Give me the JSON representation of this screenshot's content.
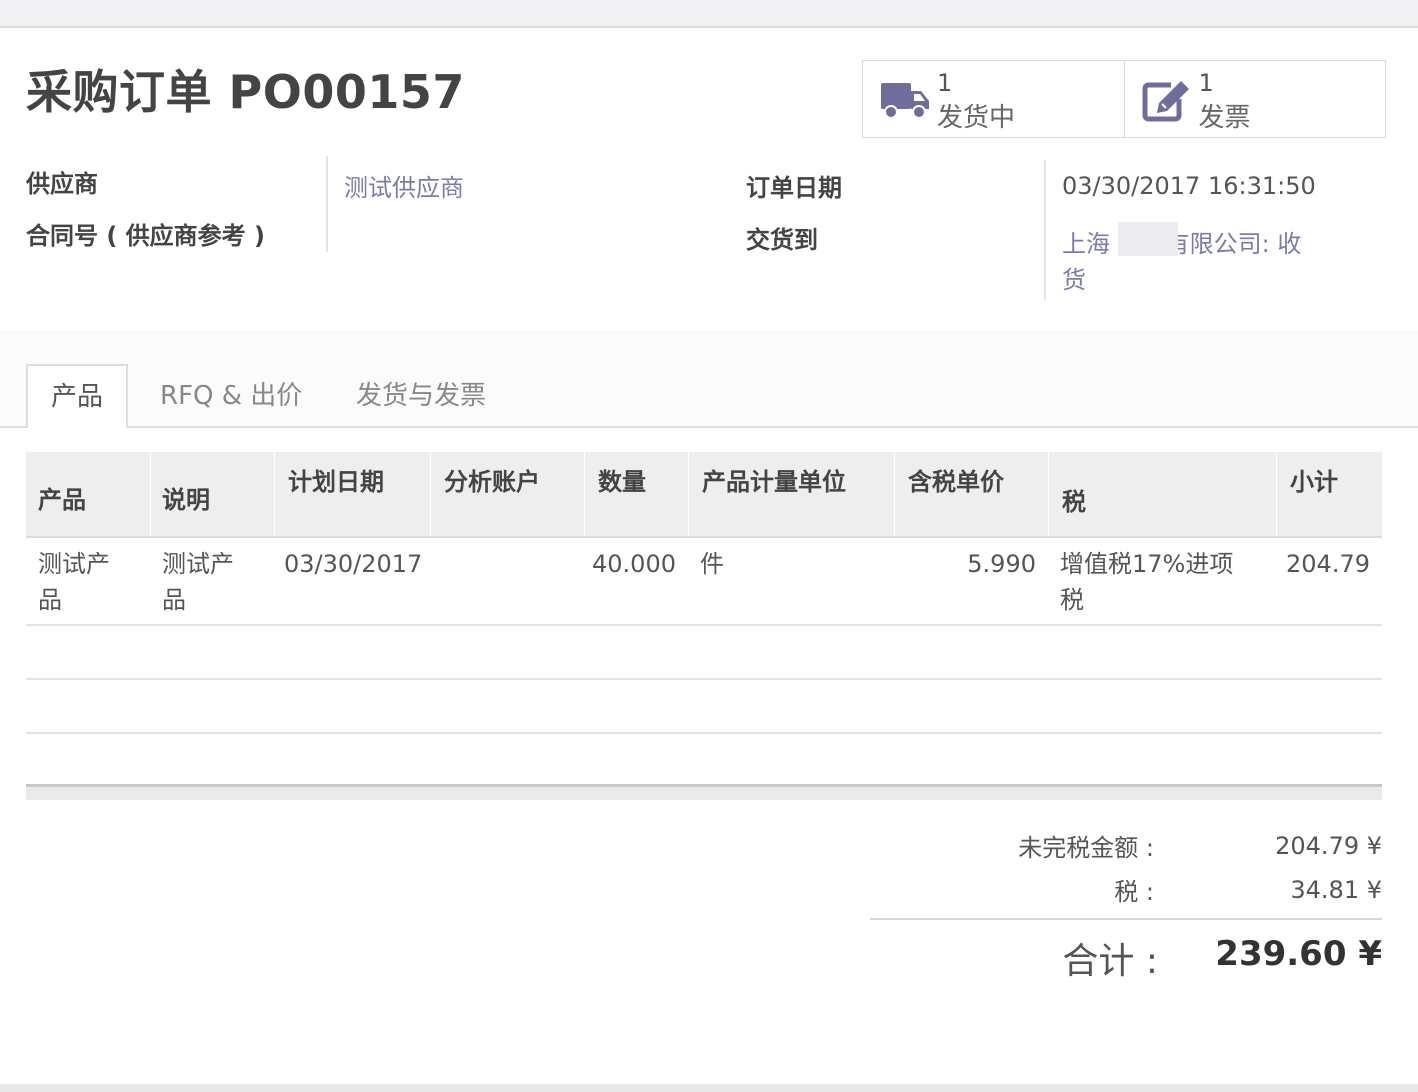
{
  "title": "采购订单 PO00157",
  "smart_buttons": [
    {
      "count": "1",
      "label": "发货中",
      "icon": "truck-icon"
    },
    {
      "count": "1",
      "label": "发票",
      "icon": "edit-icon"
    }
  ],
  "fields": {
    "vendor_label": "供应商",
    "vendor_value": "测试供应商",
    "vendor_ref_label": "合同号 ( 供应商参考 )",
    "order_date_label": "订单日期",
    "order_date_value": "03/30/2017 16:31:50",
    "deliver_to_label": "交货到",
    "deliver_to_line1": "上海    科技有限公司: 收",
    "deliver_to_line2": "货"
  },
  "tabs": [
    "产品",
    "RFQ & 出价",
    "发货与发票"
  ],
  "table": {
    "headers": [
      "产品",
      "说明",
      "计划日期",
      "分析账户",
      "数量",
      "产品计量单位",
      "含税单价",
      "税",
      "小计"
    ],
    "rows": [
      {
        "product_line1": "测试产",
        "product_line2": "品",
        "description_line1": "测试产",
        "description_line2": "品",
        "date": "03/30/2017",
        "analytic": "",
        "quantity": "40.000",
        "uom": "件",
        "unit_price": "5.990",
        "tax_line1": "增值税17%进项",
        "tax_line2": "税",
        "subtotal": "204.79"
      }
    ]
  },
  "summary": {
    "untaxed_label": "未完税金额 :",
    "untaxed_value": "204.79 ¥",
    "tax_label": "税 :",
    "tax_value": "34.81 ¥",
    "total_label": "合计 :",
    "total_value": "239.60 ¥"
  },
  "colors": {
    "link": "#7c7bad",
    "icon": "#6f6e9b"
  }
}
